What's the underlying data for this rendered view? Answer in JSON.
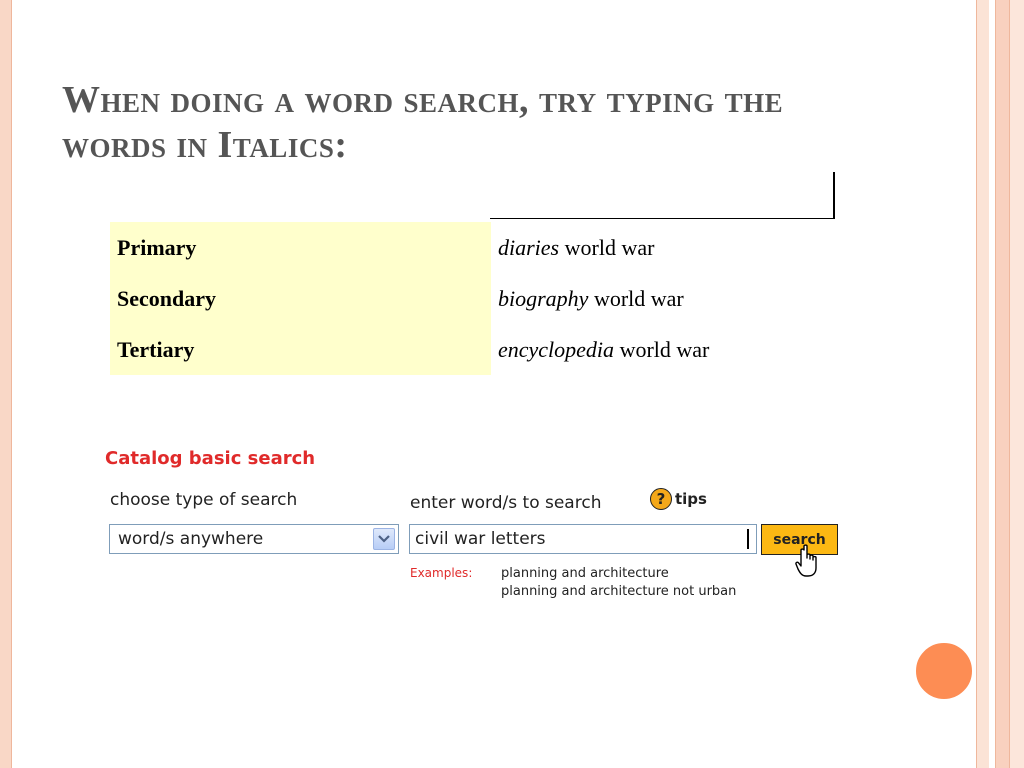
{
  "slide": {
    "title": "When doing a word search, try typing the words in Italics:"
  },
  "source_table": {
    "rows": [
      {
        "type": "Primary",
        "italic": "diaries",
        "rest": " world war"
      },
      {
        "type": "Secondary",
        "italic": "biography",
        "rest": " world war"
      },
      {
        "type": "Tertiary",
        "italic": "encyclopedia",
        "rest": " world war"
      }
    ]
  },
  "catalog": {
    "heading": "Catalog basic search",
    "type_label": "choose type of search",
    "type_selected": "word/s anywhere",
    "word_label": "enter word/s to search",
    "tips_label": "tips",
    "tips_icon_glyph": "?",
    "input_value": "civil war letters",
    "search_button": "search",
    "examples_label": "Examples:",
    "examples": [
      "planning and architecture",
      "planning and architecture not urban"
    ]
  },
  "colors": {
    "title": "#555555",
    "table_highlight": "#ffffcc",
    "catalog_red": "#e02a2a",
    "button_yellow": "#fcb813",
    "accent_orange": "#fd8d54"
  },
  "icons": [
    "help-question-icon",
    "dropdown-arrow-icon",
    "hand-pointer-icon"
  ]
}
